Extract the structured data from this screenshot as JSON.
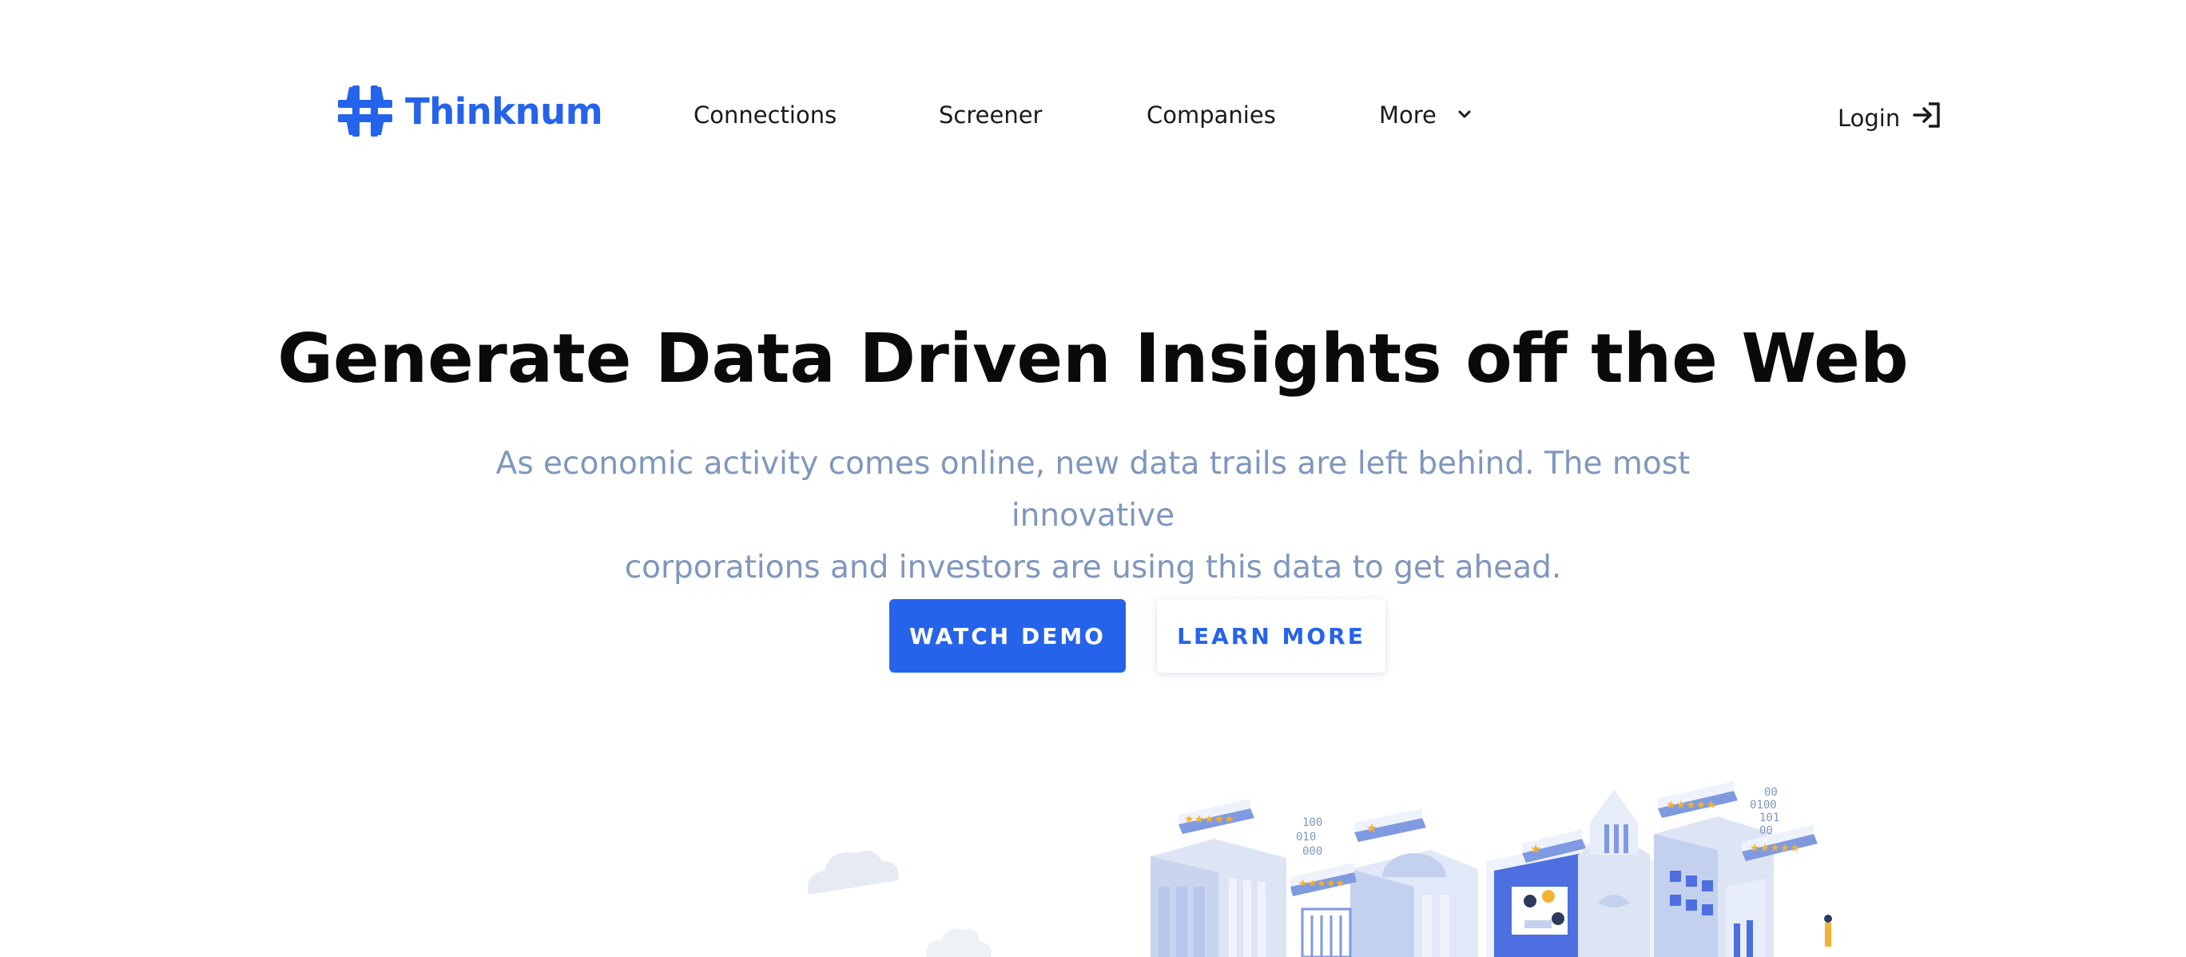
{
  "header": {
    "logo_text": "Thinknum",
    "brand_color": "#2563eb",
    "nav": [
      {
        "label": "Connections"
      },
      {
        "label": "Screener"
      },
      {
        "label": "Companies"
      },
      {
        "label": "More",
        "icon": "chevron-down-icon"
      }
    ],
    "login_label": "Login",
    "login_icon": "login-icon"
  },
  "hero": {
    "title": "Generate Data Driven Insights off the Web",
    "subtitle_line1": "As economic activity comes online, new data trails are left behind. The most innovative",
    "subtitle_line2": "corporations and investors are using this data to get ahead.",
    "subtitle_color": "#7f97bd",
    "primary_button": "WATCH DEMO",
    "secondary_button": "LEARN MORE"
  },
  "illustration": {
    "icon": "isometric-city-illustration",
    "binary_1": [
      "100",
      "010",
      "000"
    ],
    "binary_2": [
      "00",
      "0100",
      "101",
      "00"
    ]
  }
}
